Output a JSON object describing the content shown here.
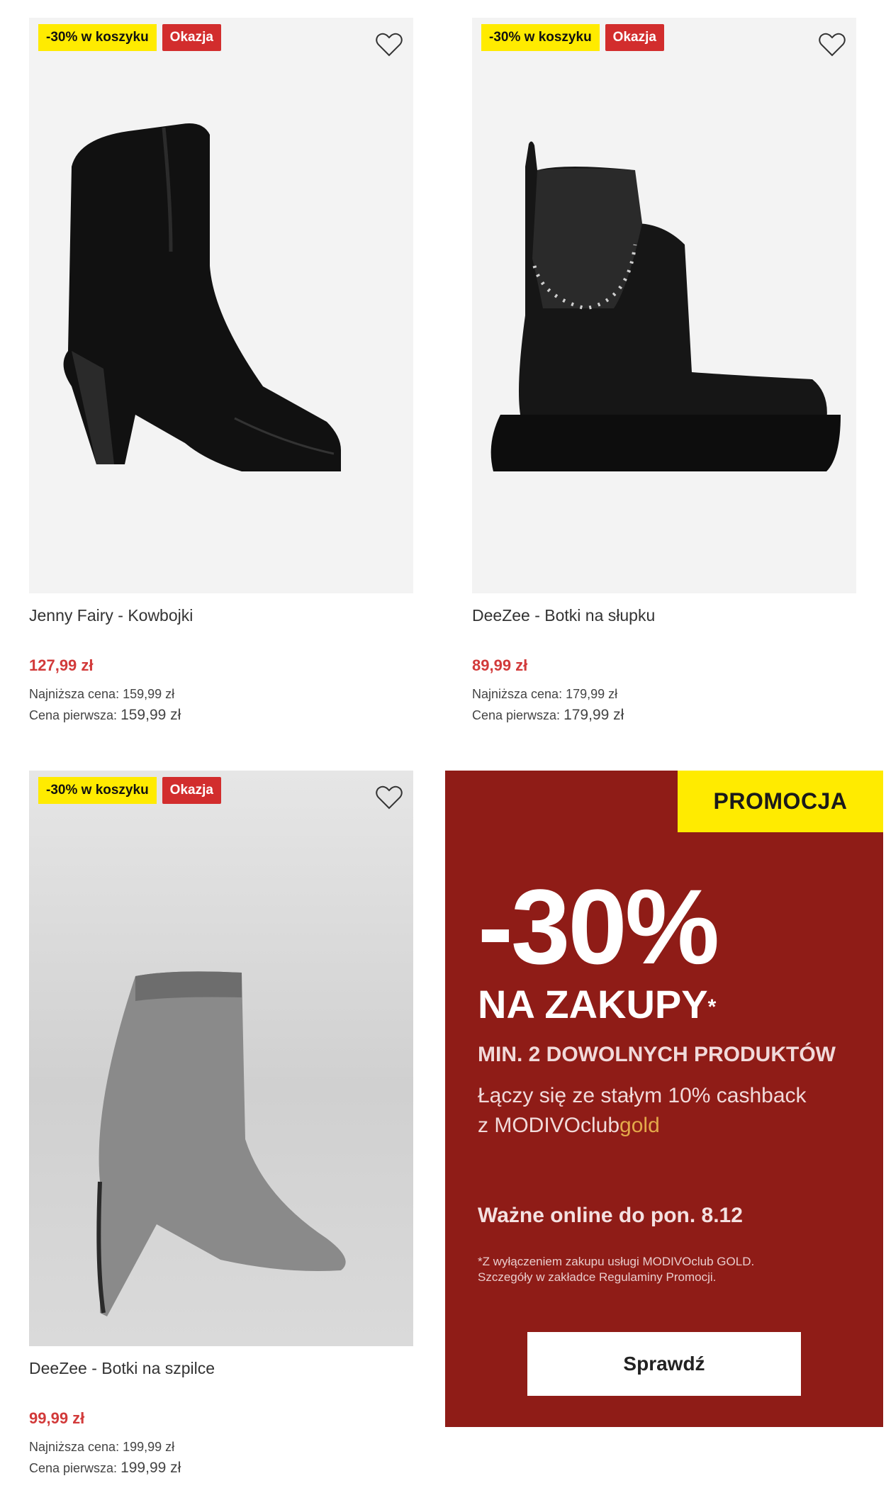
{
  "products": [
    {
      "badge_cart": "-30% w koszyku",
      "badge_deal": "Okazja",
      "name": "Jenny Fairy - Kowbojki",
      "price": "127,99 zł",
      "lowest_price_label": "Najniższa cena:",
      "lowest_price": "159,99 zł",
      "first_price_label": "Cena pierwsza:",
      "first_price": "159,99 zł"
    },
    {
      "badge_cart": "-30% w koszyku",
      "badge_deal": "Okazja",
      "name": "DeeZee - Botki na słupku",
      "price": "89,99 zł",
      "lowest_price_label": "Najniższa cena:",
      "lowest_price": "179,99 zł",
      "first_price_label": "Cena pierwsza:",
      "first_price": "179,99 zł"
    },
    {
      "badge_cart": "-30% w koszyku",
      "badge_deal": "Okazja",
      "name": "DeeZee - Botki na szpilce",
      "price": "99,99 zł",
      "lowest_price_label": "Najniższa cena:",
      "lowest_price": "199,99 zł",
      "first_price_label": "Cena pierwsza:",
      "first_price": "199,99 zł"
    }
  ],
  "promo": {
    "tag": "PROMOCJA",
    "discount": "-30%",
    "headline": "NA ZAKUPY",
    "asterisk": "*",
    "subheadline": "MIN. 2 DOWOLNYCH PRODUKTÓW",
    "line1": "Łączy się ze stałym 10% cashback",
    "line2_prefix": "z MODIVOclub",
    "line2_gold": "gold",
    "validity": "Ważne online do pon. 8.12",
    "note_line1": "*Z wyłączeniem zakupu usługi MODIVOclub GOLD.",
    "note_line2": "Szczegóły w zakładce Regulaminy Promocji.",
    "button": "Sprawdź"
  },
  "colors": {
    "sale_red": "#d23a3a",
    "badge_yellow": "#ffeb00",
    "badge_red": "#d22d2d",
    "promo_bg": "#8f1c17",
    "gold": "#e3a94a"
  }
}
